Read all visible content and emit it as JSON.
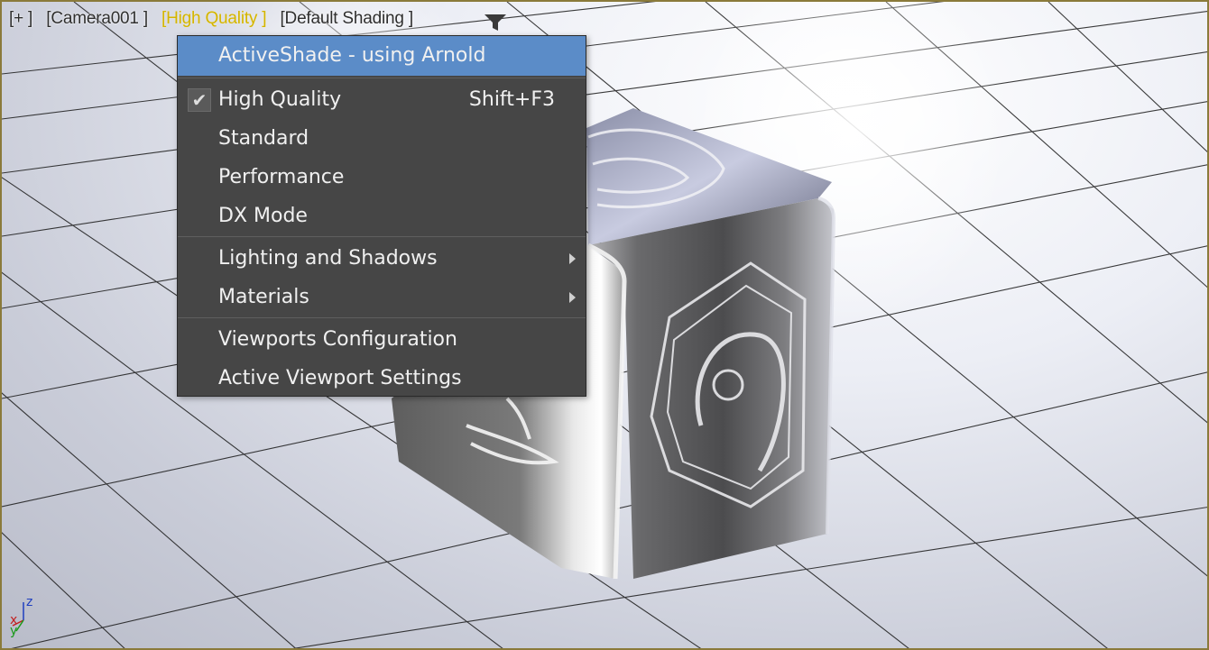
{
  "viewport": {
    "labels": [
      {
        "text": "[+ ]",
        "active": false
      },
      {
        "text": "[Camera001 ]",
        "active": false
      },
      {
        "text": "[High Quality ]",
        "active": true
      },
      {
        "text": "[Default Shading ]",
        "active": false
      }
    ],
    "filter_icon": "filter-funnel-icon",
    "axis": {
      "x": "x",
      "y": "y",
      "z": "z"
    },
    "colors": {
      "active_label": "#d3b400",
      "border": "#8a7a3a"
    }
  },
  "menu": {
    "highlight_color": "#5b8cc8",
    "activeshade": "ActiveShade - using Arnold",
    "high_quality": {
      "label": "High Quality",
      "shortcut": "Shift+F3",
      "checked": true
    },
    "standard": "Standard",
    "performance": "Performance",
    "dx_mode": "DX Mode",
    "lighting": "Lighting and Shadows",
    "materials": "Materials",
    "viewports_config": "Viewports Configuration",
    "active_viewport_settings": "Active Viewport Settings"
  }
}
